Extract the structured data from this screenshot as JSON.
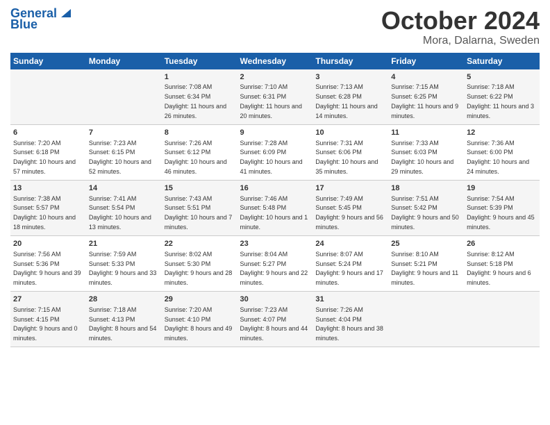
{
  "header": {
    "logo_line1": "General",
    "logo_line2": "Blue",
    "month_title": "October 2024",
    "location": "Mora, Dalarna, Sweden"
  },
  "days_of_week": [
    "Sunday",
    "Monday",
    "Tuesday",
    "Wednesday",
    "Thursday",
    "Friday",
    "Saturday"
  ],
  "weeks": [
    [
      {
        "day": "",
        "sunrise": "",
        "sunset": "",
        "daylight": ""
      },
      {
        "day": "",
        "sunrise": "",
        "sunset": "",
        "daylight": ""
      },
      {
        "day": "1",
        "sunrise": "Sunrise: 7:08 AM",
        "sunset": "Sunset: 6:34 PM",
        "daylight": "Daylight: 11 hours and 26 minutes."
      },
      {
        "day": "2",
        "sunrise": "Sunrise: 7:10 AM",
        "sunset": "Sunset: 6:31 PM",
        "daylight": "Daylight: 11 hours and 20 minutes."
      },
      {
        "day": "3",
        "sunrise": "Sunrise: 7:13 AM",
        "sunset": "Sunset: 6:28 PM",
        "daylight": "Daylight: 11 hours and 14 minutes."
      },
      {
        "day": "4",
        "sunrise": "Sunrise: 7:15 AM",
        "sunset": "Sunset: 6:25 PM",
        "daylight": "Daylight: 11 hours and 9 minutes."
      },
      {
        "day": "5",
        "sunrise": "Sunrise: 7:18 AM",
        "sunset": "Sunset: 6:22 PM",
        "daylight": "Daylight: 11 hours and 3 minutes."
      }
    ],
    [
      {
        "day": "6",
        "sunrise": "Sunrise: 7:20 AM",
        "sunset": "Sunset: 6:18 PM",
        "daylight": "Daylight: 10 hours and 57 minutes."
      },
      {
        "day": "7",
        "sunrise": "Sunrise: 7:23 AM",
        "sunset": "Sunset: 6:15 PM",
        "daylight": "Daylight: 10 hours and 52 minutes."
      },
      {
        "day": "8",
        "sunrise": "Sunrise: 7:26 AM",
        "sunset": "Sunset: 6:12 PM",
        "daylight": "Daylight: 10 hours and 46 minutes."
      },
      {
        "day": "9",
        "sunrise": "Sunrise: 7:28 AM",
        "sunset": "Sunset: 6:09 PM",
        "daylight": "Daylight: 10 hours and 41 minutes."
      },
      {
        "day": "10",
        "sunrise": "Sunrise: 7:31 AM",
        "sunset": "Sunset: 6:06 PM",
        "daylight": "Daylight: 10 hours and 35 minutes."
      },
      {
        "day": "11",
        "sunrise": "Sunrise: 7:33 AM",
        "sunset": "Sunset: 6:03 PM",
        "daylight": "Daylight: 10 hours and 29 minutes."
      },
      {
        "day": "12",
        "sunrise": "Sunrise: 7:36 AM",
        "sunset": "Sunset: 6:00 PM",
        "daylight": "Daylight: 10 hours and 24 minutes."
      }
    ],
    [
      {
        "day": "13",
        "sunrise": "Sunrise: 7:38 AM",
        "sunset": "Sunset: 5:57 PM",
        "daylight": "Daylight: 10 hours and 18 minutes."
      },
      {
        "day": "14",
        "sunrise": "Sunrise: 7:41 AM",
        "sunset": "Sunset: 5:54 PM",
        "daylight": "Daylight: 10 hours and 13 minutes."
      },
      {
        "day": "15",
        "sunrise": "Sunrise: 7:43 AM",
        "sunset": "Sunset: 5:51 PM",
        "daylight": "Daylight: 10 hours and 7 minutes."
      },
      {
        "day": "16",
        "sunrise": "Sunrise: 7:46 AM",
        "sunset": "Sunset: 5:48 PM",
        "daylight": "Daylight: 10 hours and 1 minute."
      },
      {
        "day": "17",
        "sunrise": "Sunrise: 7:49 AM",
        "sunset": "Sunset: 5:45 PM",
        "daylight": "Daylight: 9 hours and 56 minutes."
      },
      {
        "day": "18",
        "sunrise": "Sunrise: 7:51 AM",
        "sunset": "Sunset: 5:42 PM",
        "daylight": "Daylight: 9 hours and 50 minutes."
      },
      {
        "day": "19",
        "sunrise": "Sunrise: 7:54 AM",
        "sunset": "Sunset: 5:39 PM",
        "daylight": "Daylight: 9 hours and 45 minutes."
      }
    ],
    [
      {
        "day": "20",
        "sunrise": "Sunrise: 7:56 AM",
        "sunset": "Sunset: 5:36 PM",
        "daylight": "Daylight: 9 hours and 39 minutes."
      },
      {
        "day": "21",
        "sunrise": "Sunrise: 7:59 AM",
        "sunset": "Sunset: 5:33 PM",
        "daylight": "Daylight: 9 hours and 33 minutes."
      },
      {
        "day": "22",
        "sunrise": "Sunrise: 8:02 AM",
        "sunset": "Sunset: 5:30 PM",
        "daylight": "Daylight: 9 hours and 28 minutes."
      },
      {
        "day": "23",
        "sunrise": "Sunrise: 8:04 AM",
        "sunset": "Sunset: 5:27 PM",
        "daylight": "Daylight: 9 hours and 22 minutes."
      },
      {
        "day": "24",
        "sunrise": "Sunrise: 8:07 AM",
        "sunset": "Sunset: 5:24 PM",
        "daylight": "Daylight: 9 hours and 17 minutes."
      },
      {
        "day": "25",
        "sunrise": "Sunrise: 8:10 AM",
        "sunset": "Sunset: 5:21 PM",
        "daylight": "Daylight: 9 hours and 11 minutes."
      },
      {
        "day": "26",
        "sunrise": "Sunrise: 8:12 AM",
        "sunset": "Sunset: 5:18 PM",
        "daylight": "Daylight: 9 hours and 6 minutes."
      }
    ],
    [
      {
        "day": "27",
        "sunrise": "Sunrise: 7:15 AM",
        "sunset": "Sunset: 4:15 PM",
        "daylight": "Daylight: 9 hours and 0 minutes."
      },
      {
        "day": "28",
        "sunrise": "Sunrise: 7:18 AM",
        "sunset": "Sunset: 4:13 PM",
        "daylight": "Daylight: 8 hours and 54 minutes."
      },
      {
        "day": "29",
        "sunrise": "Sunrise: 7:20 AM",
        "sunset": "Sunset: 4:10 PM",
        "daylight": "Daylight: 8 hours and 49 minutes."
      },
      {
        "day": "30",
        "sunrise": "Sunrise: 7:23 AM",
        "sunset": "Sunset: 4:07 PM",
        "daylight": "Daylight: 8 hours and 44 minutes."
      },
      {
        "day": "31",
        "sunrise": "Sunrise: 7:26 AM",
        "sunset": "Sunset: 4:04 PM",
        "daylight": "Daylight: 8 hours and 38 minutes."
      },
      {
        "day": "",
        "sunrise": "",
        "sunset": "",
        "daylight": ""
      },
      {
        "day": "",
        "sunrise": "",
        "sunset": "",
        "daylight": ""
      }
    ]
  ]
}
